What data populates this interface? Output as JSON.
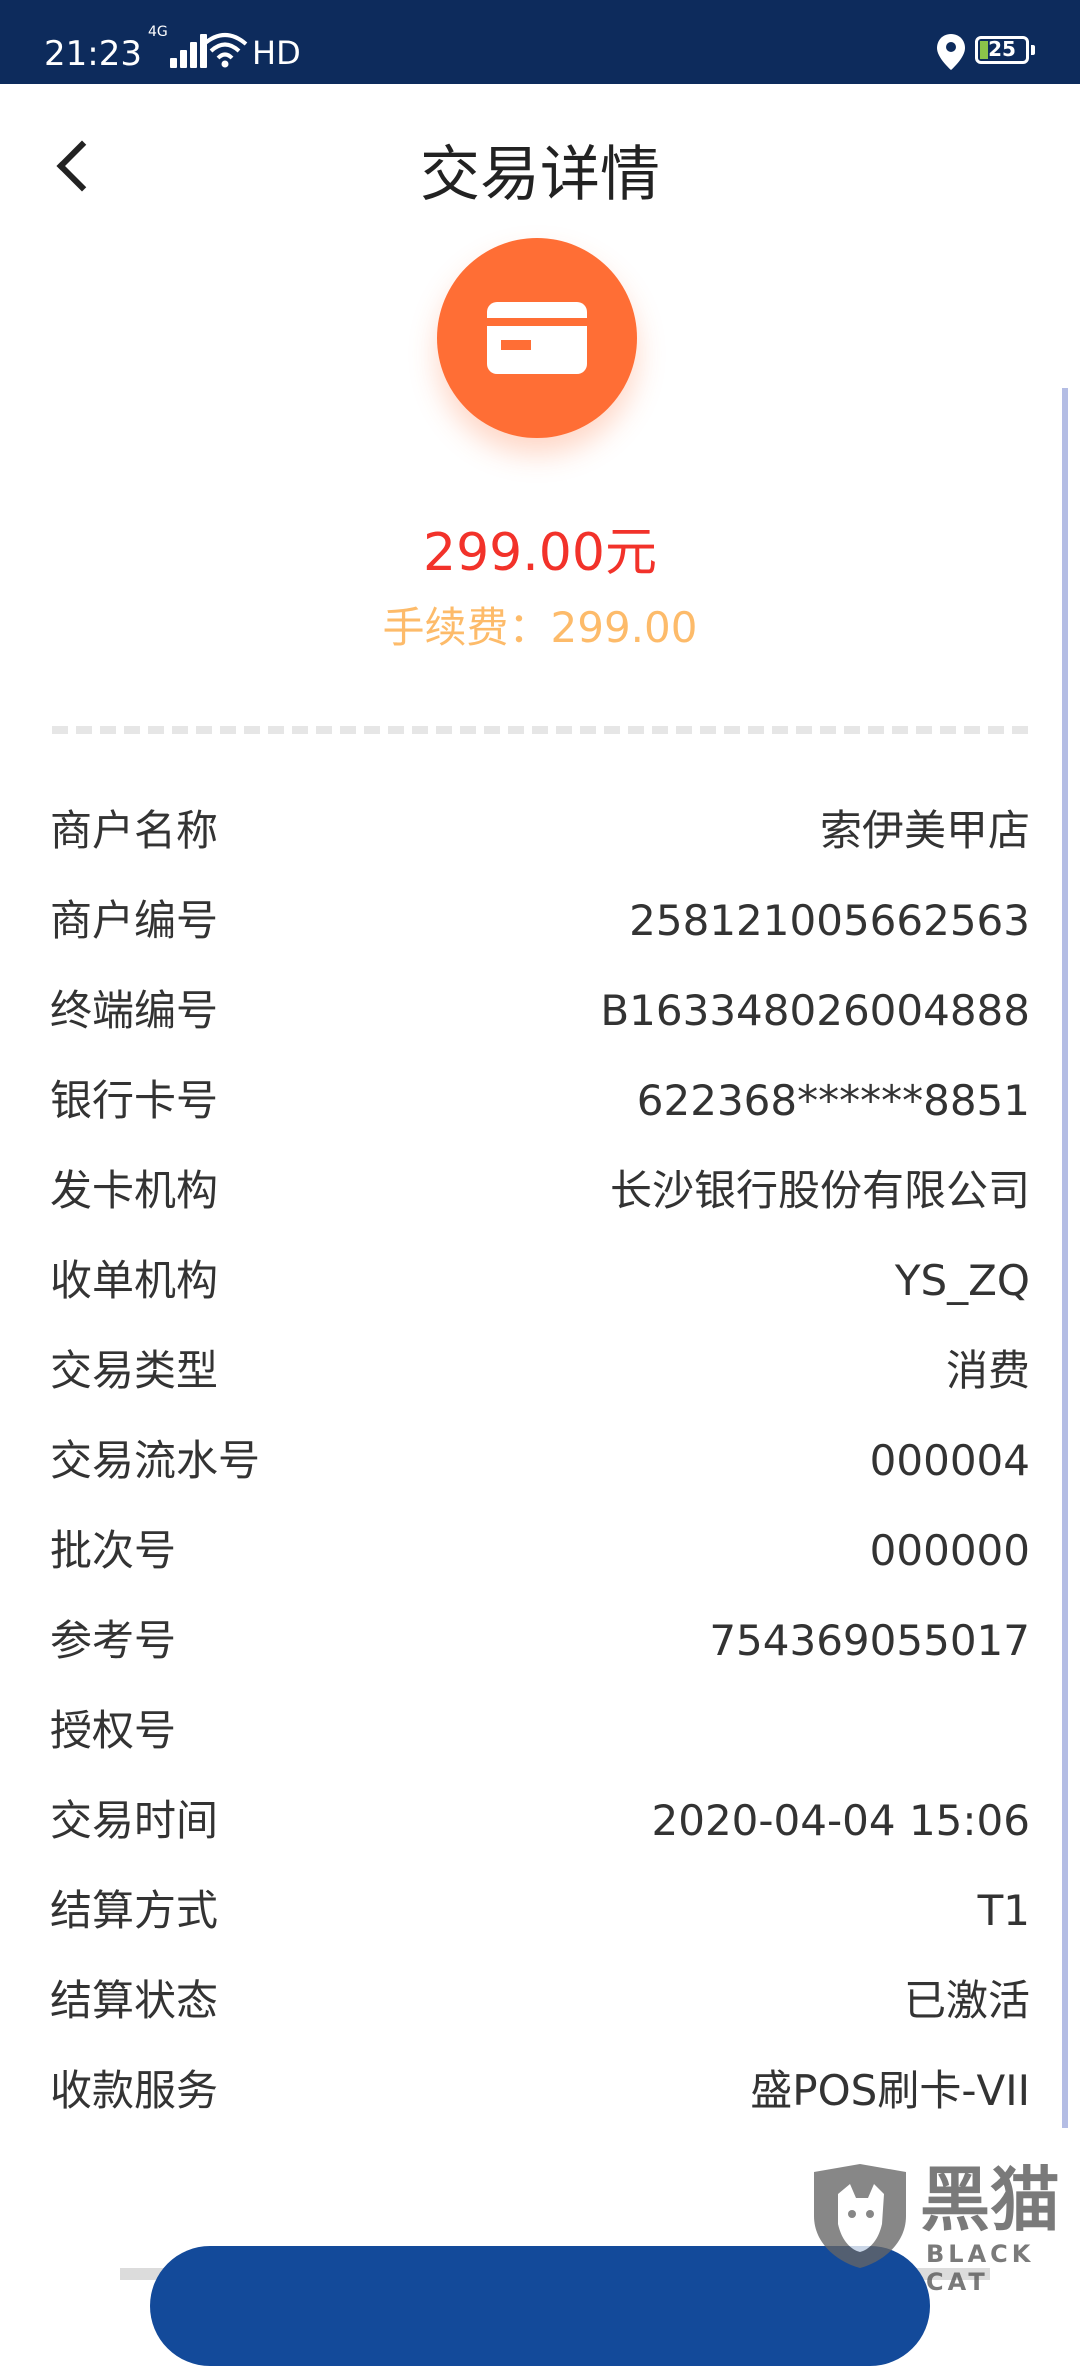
{
  "status_bar": {
    "time": "21:23",
    "network": "4G",
    "wifi": "HD",
    "battery": "25",
    "icons": [
      "signal-icon",
      "wifi-icon",
      "location-icon",
      "battery-icon"
    ]
  },
  "header": {
    "title": "交易详情",
    "back_icon": "chevron-left-icon"
  },
  "summary": {
    "icon": "credit-card-icon",
    "icon_color": "#ff6e35",
    "amount": "299.00元",
    "amount_color": "#f2322a",
    "fee": "手续费：299.00",
    "fee_color": "#fdbb6a"
  },
  "details": [
    {
      "label": "商户名称",
      "value": "索伊美甲店"
    },
    {
      "label": "商户编号",
      "value": "258121005662563"
    },
    {
      "label": "终端编号",
      "value": "B163348026004888"
    },
    {
      "label": "银行卡号",
      "value": "622368******8851"
    },
    {
      "label": "发卡机构",
      "value": "长沙银行股份有限公司"
    },
    {
      "label": "收单机构",
      "value": "YS_ZQ"
    },
    {
      "label": "交易类型",
      "value": "消费"
    },
    {
      "label": "交易流水号",
      "value": "000004"
    },
    {
      "label": "批次号",
      "value": "000000"
    },
    {
      "label": "参考号",
      "value": "754369055017"
    },
    {
      "label": "授权号",
      "value": ""
    },
    {
      "label": "交易时间",
      "value": "2020-04-04 15:06"
    },
    {
      "label": "结算方式",
      "value": "T1"
    },
    {
      "label": "结算状态",
      "value": "已激活"
    },
    {
      "label": "收款服务",
      "value": "盛POS刷卡-VII"
    }
  ],
  "watermark": {
    "main": "黑猫",
    "sub": "BLACK CAT"
  }
}
